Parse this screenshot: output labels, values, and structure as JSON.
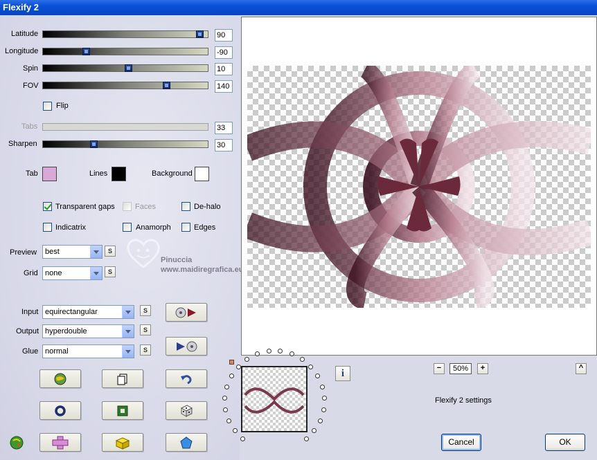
{
  "window": {
    "title": "Flexify 2"
  },
  "sliders": [
    {
      "label": "Latitude",
      "value": "90",
      "level": 0.975
    },
    {
      "label": "Longitude",
      "value": "-90",
      "level": 0.25
    },
    {
      "label": "Spin",
      "value": "10",
      "level": 0.52
    },
    {
      "label": "FOV",
      "value": "140",
      "level": 0.76
    }
  ],
  "flip": {
    "label": "Flip",
    "checked": false
  },
  "tabs": {
    "label": "Tabs",
    "value": "33",
    "disabled": true
  },
  "sharpen": {
    "label": "Sharpen",
    "value": "30",
    "level": 0.3
  },
  "colors": {
    "tab": {
      "label": "Tab",
      "color": "#d8a8d8"
    },
    "lines": {
      "label": "Lines",
      "color": "#000000"
    },
    "background": {
      "label": "Background",
      "color": "#ffffff"
    }
  },
  "options": {
    "transparent_gaps": {
      "label": "Transparent gaps",
      "checked": true
    },
    "faces": {
      "label": "Faces",
      "checked": false,
      "disabled": true
    },
    "de_halo": {
      "label": "De-halo",
      "checked": false
    },
    "indicatrix": {
      "label": "Indicatrix",
      "checked": false
    },
    "anamorph": {
      "label": "Anamorph",
      "checked": false
    },
    "edges": {
      "label": "Edges",
      "checked": false
    }
  },
  "preview": {
    "label": "Preview",
    "value": "best"
  },
  "grid": {
    "label": "Grid",
    "value": "none"
  },
  "input": {
    "label": "Input",
    "value": "equirectangular"
  },
  "output": {
    "label": "Output",
    "value": "hyperdouble"
  },
  "glue": {
    "label": "Glue",
    "value": "normal"
  },
  "s_button_label": "S",
  "watermark": {
    "line1": "Pinuccia",
    "line2": "www.maidiregrafica.eu"
  },
  "zoom": {
    "minus": "−",
    "value": "50%",
    "plus": "+"
  },
  "settings_label": "Flexify 2 settings",
  "collapse_label": "^",
  "buttons": {
    "cancel": "Cancel",
    "ok": "OK"
  },
  "accent_colors": {
    "title_bar": "#0a4fd6",
    "panel": "#d9dae8",
    "pattern": "#8a4a5e"
  }
}
